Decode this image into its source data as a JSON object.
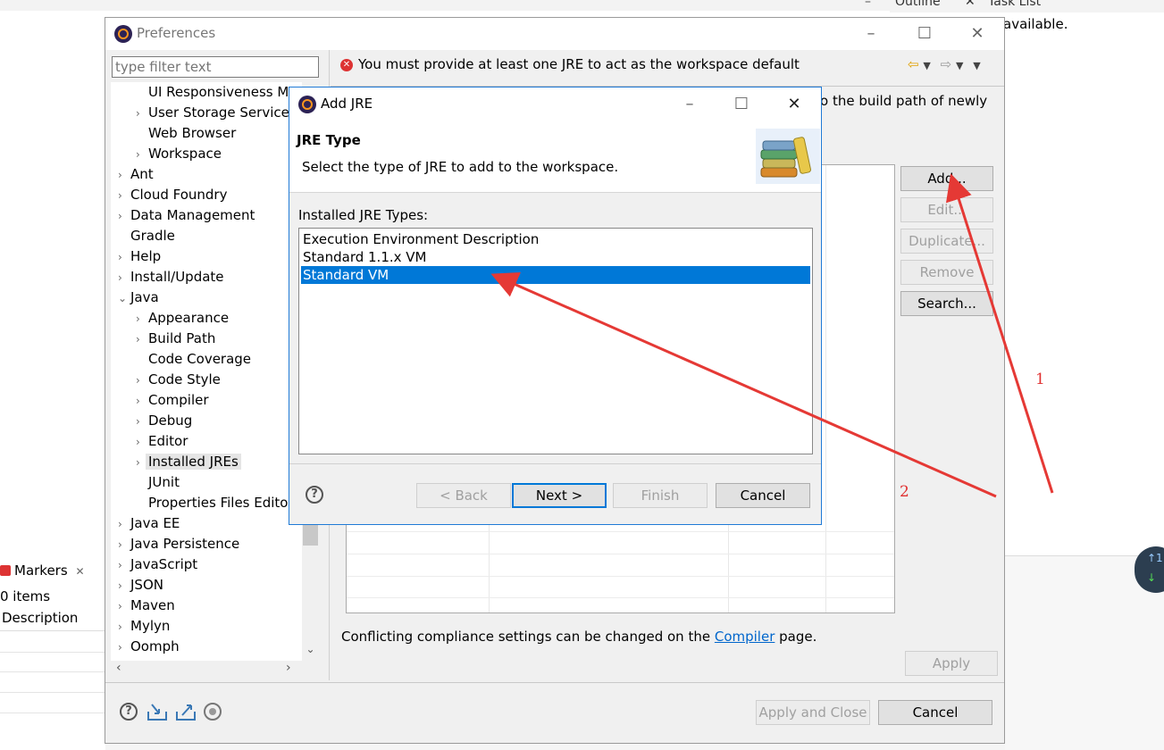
{
  "background": {
    "outline_tab": "Outline",
    "task_list_tab": "Task List",
    "available_text": "available.",
    "markers_tab": "Markers",
    "items_count": "0 items",
    "description_col": "Description",
    "widget_up": "↑1",
    "widget_down": "↓"
  },
  "preferences": {
    "title": "Preferences",
    "filter_placeholder": "type filter text",
    "error_message": "You must provide at least one JRE to act as the workspace default",
    "build_path_text": "o the build path of newly",
    "tree": [
      {
        "label": "UI Responsiveness M",
        "level": 2,
        "arrow": ""
      },
      {
        "label": "User Storage Service",
        "level": 2,
        "arrow": "›"
      },
      {
        "label": "Web Browser",
        "level": 2,
        "arrow": ""
      },
      {
        "label": "Workspace",
        "level": 2,
        "arrow": "›"
      },
      {
        "label": "Ant",
        "level": 1,
        "arrow": "›"
      },
      {
        "label": "Cloud Foundry",
        "level": 1,
        "arrow": "›"
      },
      {
        "label": "Data Management",
        "level": 1,
        "arrow": "›"
      },
      {
        "label": "Gradle",
        "level": 1,
        "arrow": ""
      },
      {
        "label": "Help",
        "level": 1,
        "arrow": "›"
      },
      {
        "label": "Install/Update",
        "level": 1,
        "arrow": "›"
      },
      {
        "label": "Java",
        "level": 1,
        "arrow": "⌄"
      },
      {
        "label": "Appearance",
        "level": 2,
        "arrow": "›"
      },
      {
        "label": "Build Path",
        "level": 2,
        "arrow": "›"
      },
      {
        "label": "Code Coverage",
        "level": 2,
        "arrow": ""
      },
      {
        "label": "Code Style",
        "level": 2,
        "arrow": "›"
      },
      {
        "label": "Compiler",
        "level": 2,
        "arrow": "›"
      },
      {
        "label": "Debug",
        "level": 2,
        "arrow": "›"
      },
      {
        "label": "Editor",
        "level": 2,
        "arrow": "›"
      },
      {
        "label": "Installed JREs",
        "level": 2,
        "arrow": "›",
        "selected": true
      },
      {
        "label": "JUnit",
        "level": 2,
        "arrow": ""
      },
      {
        "label": "Properties Files Edito",
        "level": 2,
        "arrow": ""
      },
      {
        "label": "Java EE",
        "level": 1,
        "arrow": "›"
      },
      {
        "label": "Java Persistence",
        "level": 1,
        "arrow": "›"
      },
      {
        "label": "JavaScript",
        "level": 1,
        "arrow": "›"
      },
      {
        "label": "JSON",
        "level": 1,
        "arrow": "›"
      },
      {
        "label": "Maven",
        "level": 1,
        "arrow": "›"
      },
      {
        "label": "Mylyn",
        "level": 1,
        "arrow": "›"
      },
      {
        "label": "Oomph",
        "level": 1,
        "arrow": "›"
      }
    ],
    "buttons": {
      "add": "Add...",
      "edit": "Edit...",
      "duplicate": "Duplicate...",
      "remove": "Remove",
      "search": "Search..."
    },
    "conflict_text_before": "Conflicting compliance settings can be changed on the ",
    "conflict_link": "Compiler",
    "conflict_text_after": " page.",
    "apply": "Apply",
    "apply_and_close": "Apply and Close",
    "cancel": "Cancel"
  },
  "dialog": {
    "title": "Add JRE",
    "header": "JRE Type",
    "description": "Select the type of JRE to add to the workspace.",
    "list_label": "Installed JRE Types:",
    "jre_types": [
      {
        "label": "Execution Environment Description",
        "selected": false
      },
      {
        "label": "Standard 1.1.x VM",
        "selected": false
      },
      {
        "label": "Standard VM",
        "selected": true
      }
    ],
    "back": "< Back",
    "next": "Next >",
    "finish": "Finish",
    "cancel": "Cancel"
  },
  "annotations": {
    "label_1": "1",
    "label_2": "2",
    "color": "#e53935"
  }
}
